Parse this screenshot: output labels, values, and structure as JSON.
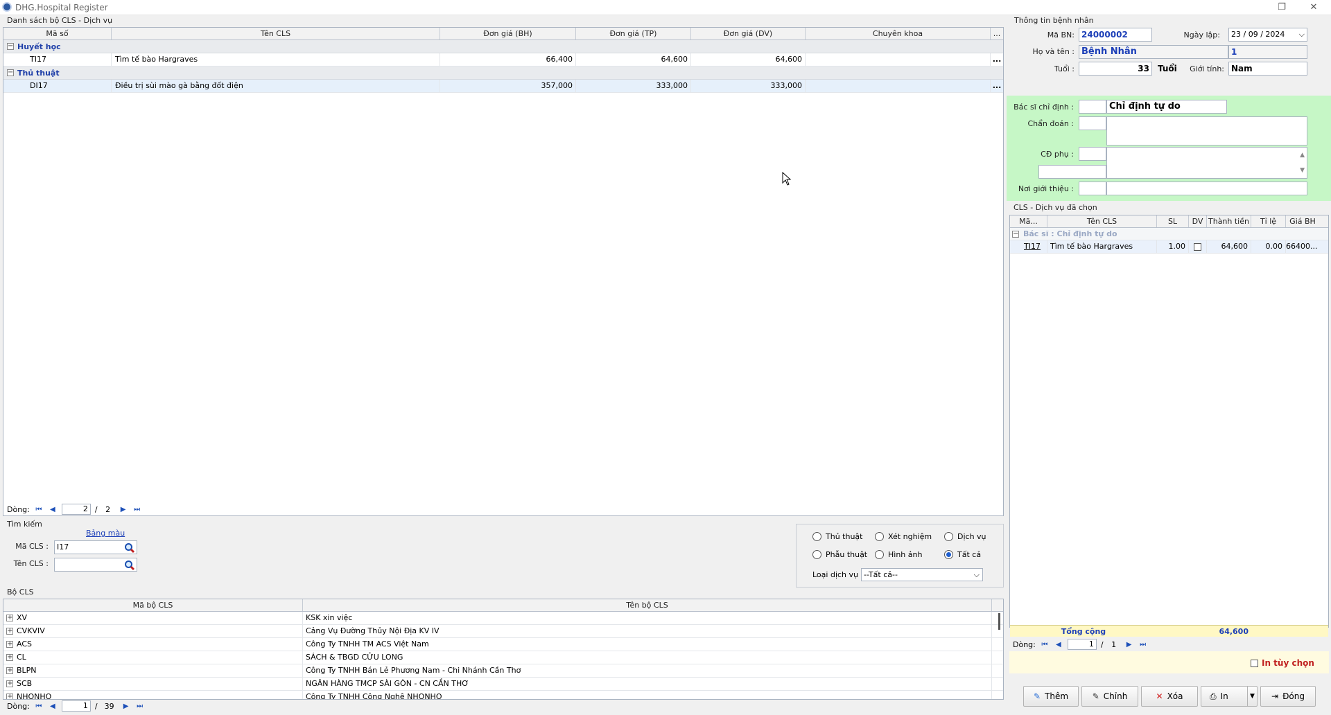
{
  "window": {
    "title": "DHG.Hospital Register",
    "restore_icon": "restore-icon",
    "close_icon": "close-icon"
  },
  "left_top": {
    "section_title": "Danh sách bộ CLS - Dịch vụ",
    "columns": [
      "Mã số",
      "Tên CLS",
      "Đơn giá (BH)",
      "Đơn giá (TP)",
      "Đơn giá (DV)",
      "Chuyên khoa",
      "..."
    ],
    "groups": [
      {
        "name": "Huyết học",
        "rows": [
          {
            "code": "TI17",
            "name": "Tìm tế bào Hargraves",
            "bh": "66,400",
            "tp": "64,600",
            "dv": "64,600",
            "ck": "",
            "more": "..."
          }
        ]
      },
      {
        "name": "Thủ thuật",
        "rows": [
          {
            "code": "DI17",
            "name": "Điều trị sùi mào gà bằng đốt điện",
            "bh": "357,000",
            "tp": "333,000",
            "dv": "333,000",
            "ck": "",
            "more": "..."
          }
        ]
      }
    ],
    "pager": {
      "label": "Dòng:",
      "current": "2",
      "total": "2"
    }
  },
  "search": {
    "section_title": "Tìm kiếm",
    "color_link": "Bảng màu",
    "ma_cls_label": "Mã CLS :",
    "ma_cls_value": "I17",
    "ten_cls_label": "Tên CLS :",
    "ten_cls_value": "",
    "radios": [
      {
        "label": "Thủ thuật",
        "checked": false
      },
      {
        "label": "Xét nghiệm",
        "checked": false
      },
      {
        "label": "Dịch vụ",
        "checked": false
      },
      {
        "label": "Phẫu thuật",
        "checked": false
      },
      {
        "label": "Hình ảnh",
        "checked": false
      },
      {
        "label": "Tất cả",
        "checked": true
      }
    ],
    "loai_dv_label": "Loại dịch vụ :",
    "loai_dv_value": "--Tất cả--"
  },
  "bo_cls": {
    "section_title": "Bộ CLS",
    "columns": [
      "Mã bộ CLS",
      "Tên bộ CLS"
    ],
    "rows": [
      {
        "code": "XV",
        "name": "KSK xin việc"
      },
      {
        "code": "CVKVIV",
        "name": "Cảng Vụ Đường Thủy Nội Địa KV IV"
      },
      {
        "code": "ACS",
        "name": "Công Ty TNHH TM ACS Việt Nam"
      },
      {
        "code": "CL",
        "name": "SÁCH & TBGD CỬU LONG"
      },
      {
        "code": "BLPN",
        "name": "Công Ty TNHH Bán Lẻ Phương Nam - Chi Nhánh Cần Thơ"
      },
      {
        "code": "SCB",
        "name": "NGÂN HÀNG TMCP SÀI GÒN - CN CẦN THƠ"
      },
      {
        "code": "NHONHO",
        "name": "Công Ty TNHH Công Nghệ NHONHO"
      }
    ],
    "pager": {
      "label": "Dòng:",
      "current": "1",
      "total": "39"
    }
  },
  "patient": {
    "section_title": "Thông tin bệnh nhân",
    "ma_bn_label": "Mã BN:",
    "ma_bn": "24000002",
    "ngay_lap_label": "Ngày lập:",
    "ngay_lap": "23 / 09 / 2024",
    "ho_ten_label": "Họ và tên :",
    "ho_ten": "Bệnh Nhân",
    "ho_ten_extra": "1",
    "tuoi_label": "Tuổi :",
    "tuoi": "33",
    "tuoi_unit": "Tuổi",
    "gioi_tinh_label": "Giới tính:",
    "gioi_tinh": "Nam"
  },
  "doctor": {
    "bac_si_label": "Bác sĩ chỉ định :",
    "bac_si_value": "Chỉ định tự do",
    "chan_doan_label": "Chẩn đoán :",
    "cd_phu_label": "CĐ phụ :",
    "noi_gioi_thieu_label": "Nơi giới thiệu :",
    "bg_color": "#c6f7c6"
  },
  "selected": {
    "section_title": "CLS - Dịch vụ đã chọn",
    "columns": [
      "Mã...",
      "Tên CLS",
      "SL",
      "DV",
      "Thành tiền",
      "Tỉ lệ",
      "Giá BH"
    ],
    "group_label": "Bác sĩ : Chỉ định tự do",
    "rows": [
      {
        "code": "TI17",
        "name": "Tìm tế bào Hargraves",
        "sl": "1.00",
        "dv": false,
        "thanh_tien": "64,600",
        "ti_le": "0.00",
        "gia_bh": "66400..."
      }
    ],
    "total_label": "Tổng cộng",
    "total_value": "64,600",
    "pager": {
      "label": "Dòng:",
      "current": "1",
      "total": "1"
    },
    "in_tuy_chon": "In tùy chọn"
  },
  "actions": {
    "them": "Thêm",
    "chinh": "Chỉnh",
    "xoa": "Xóa",
    "in": "In",
    "dong": "Đóng"
  }
}
